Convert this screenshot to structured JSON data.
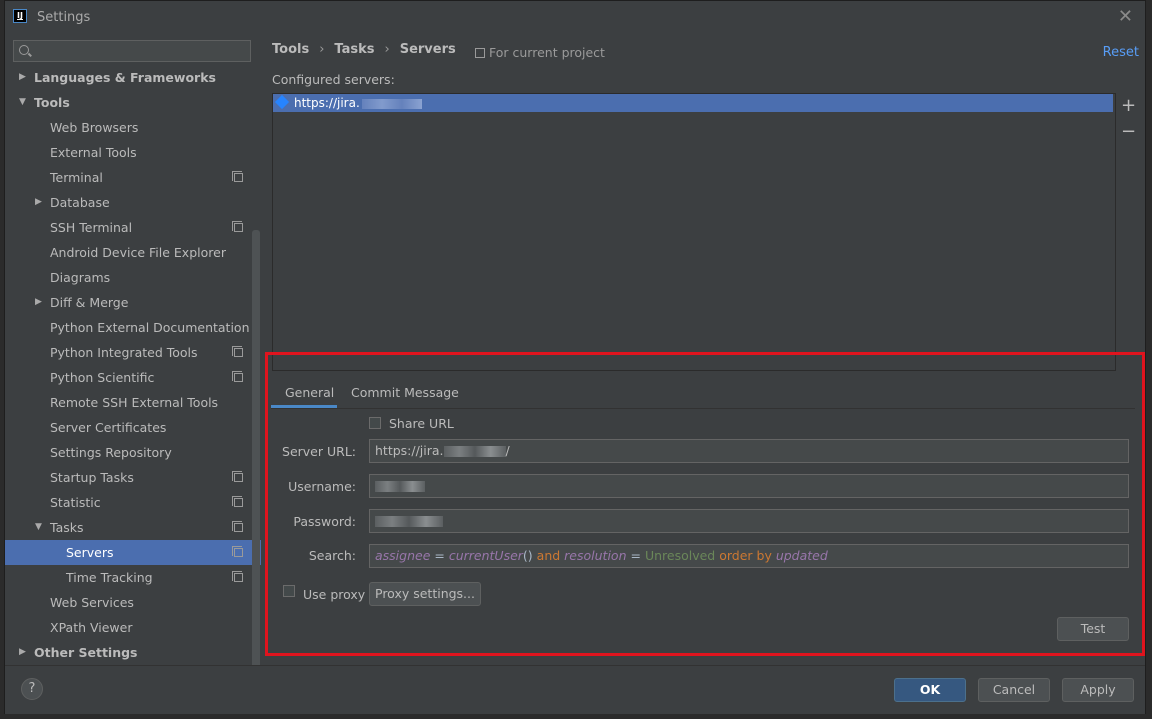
{
  "window": {
    "title": "Settings"
  },
  "sidebar": {
    "search_placeholder": "",
    "items": [
      {
        "label": "Languages & Frameworks",
        "level": 0,
        "expanded": false,
        "bold": true
      },
      {
        "label": "Tools",
        "level": 0,
        "expanded": true,
        "bold": true
      },
      {
        "label": "Web Browsers",
        "level": 1
      },
      {
        "label": "External Tools",
        "level": 1
      },
      {
        "label": "Terminal",
        "level": 1,
        "project_icon": true
      },
      {
        "label": "Database",
        "level": 1,
        "expandable": true
      },
      {
        "label": "SSH Terminal",
        "level": 1,
        "project_icon": true
      },
      {
        "label": "Android Device File Explorer",
        "level": 1
      },
      {
        "label": "Diagrams",
        "level": 1
      },
      {
        "label": "Diff & Merge",
        "level": 1,
        "expandable": true
      },
      {
        "label": "Python External Documentation",
        "level": 1
      },
      {
        "label": "Python Integrated Tools",
        "level": 1,
        "project_icon": true
      },
      {
        "label": "Python Scientific",
        "level": 1,
        "project_icon": true
      },
      {
        "label": "Remote SSH External Tools",
        "level": 1
      },
      {
        "label": "Server Certificates",
        "level": 1
      },
      {
        "label": "Settings Repository",
        "level": 1
      },
      {
        "label": "Startup Tasks",
        "level": 1,
        "project_icon": true
      },
      {
        "label": "Statistic",
        "level": 1,
        "project_icon": true
      },
      {
        "label": "Tasks",
        "level": 1,
        "expanded": true,
        "project_icon": true
      },
      {
        "label": "Servers",
        "level": 2,
        "selected": true,
        "project_icon": true
      },
      {
        "label": "Time Tracking",
        "level": 2,
        "project_icon": true
      },
      {
        "label": "Web Services",
        "level": 1
      },
      {
        "label": "XPath Viewer",
        "level": 1
      },
      {
        "label": "Other Settings",
        "level": 0,
        "expanded": false,
        "bold": true
      }
    ]
  },
  "header": {
    "breadcrumb": [
      "Tools",
      "Tasks",
      "Servers"
    ],
    "scope": "For current project",
    "reset": "Reset"
  },
  "servers": {
    "label": "Configured servers:",
    "list": [
      {
        "url": "https://jira."
      }
    ]
  },
  "tabs": [
    "General",
    "Commit Message"
  ],
  "form": {
    "share_url": "Share URL",
    "server_url_label": "Server URL:",
    "server_url_value": "https://jira.",
    "server_url_suffix": "/",
    "username_label": "Username:",
    "password_label": "Password:",
    "search_label": "Search:",
    "search_query": [
      {
        "text": "assignee",
        "style": "q1"
      },
      {
        "text": " = ",
        "style": "q2"
      },
      {
        "text": "currentUser",
        "style": "q1"
      },
      {
        "text": "() ",
        "style": "q2"
      },
      {
        "text": "and",
        "style": "q3"
      },
      {
        "text": " ",
        "style": "q2"
      },
      {
        "text": "resolution",
        "style": "q1"
      },
      {
        "text": " = ",
        "style": "q2"
      },
      {
        "text": "Unresolved",
        "style": "q4"
      },
      {
        "text": " order by ",
        "style": "q3"
      },
      {
        "text": "updated",
        "style": "q1"
      }
    ],
    "use_proxy": "Use proxy",
    "proxy_settings": "Proxy settings...",
    "test": "Test"
  },
  "footer": {
    "help": "?",
    "ok": "OK",
    "cancel": "Cancel",
    "apply": "Apply"
  },
  "colors": {
    "accent": "#4b6eaf",
    "highlight_border": "#e0141e",
    "link": "#589df6"
  }
}
